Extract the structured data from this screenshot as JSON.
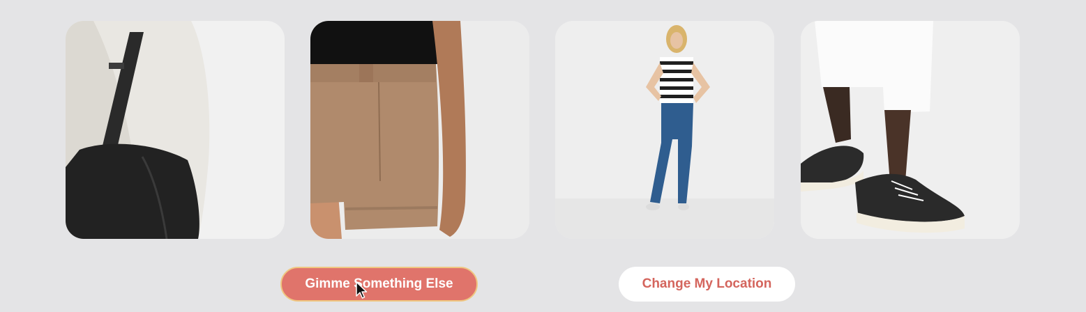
{
  "products": [
    {
      "image": "black-leather-tote-bag",
      "image_icon": "tote-bag-image"
    },
    {
      "image": "tan-high-waisted-shorts",
      "image_icon": "shorts-image"
    },
    {
      "image": "striped-tee-and-blue-jeans",
      "image_icon": "outfit-image"
    },
    {
      "image": "black-canvas-sneakers",
      "image_icon": "sneakers-image"
    }
  ],
  "actions": {
    "gimme_label": "Gimme Something Else",
    "location_label": "Change My Location"
  },
  "colors": {
    "background": "#e4e4e6",
    "primary_button": "#e0746b",
    "primary_button_border": "#efc781",
    "secondary_button": "#ffffff",
    "secondary_text": "#d4655d"
  }
}
